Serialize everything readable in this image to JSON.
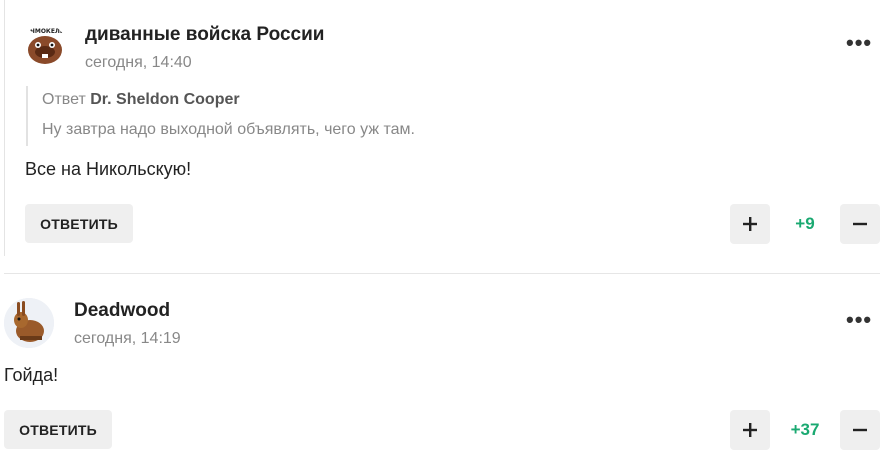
{
  "comments": [
    {
      "author": "диванные войска России",
      "time": "сегодня, 14:40",
      "quote_prefix": "Ответ",
      "quote_author": "Dr. Sheldon Cooper",
      "quote_text": "Ну завтра надо выходной объявлять, чего уж там.",
      "text": "Все на Никольскую!",
      "reply_label": "ОТВЕТИТЬ",
      "score": "+9",
      "more_icon": "more-dots-icon",
      "avatar_caption": "ЧМОКЕЛЬ"
    },
    {
      "author": "Deadwood",
      "time": "сегодня, 14:19",
      "text": "Гойда!",
      "reply_label": "ОТВЕТИТЬ",
      "score": "+37",
      "more_icon": "more-dots-icon"
    }
  ],
  "colors": {
    "score_positive": "#1aa971",
    "button_bg": "#efefef",
    "muted_text": "#888888"
  }
}
